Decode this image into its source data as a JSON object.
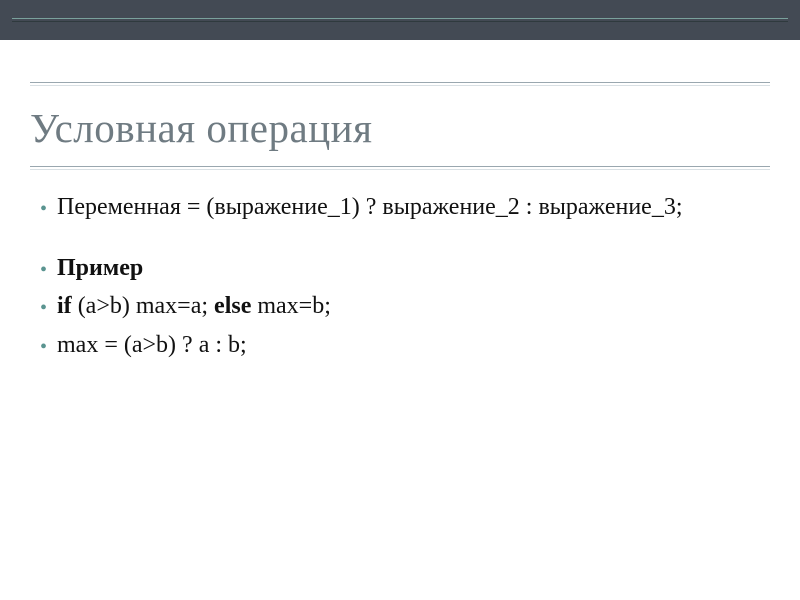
{
  "title": "Условная операция",
  "items": [
    {
      "parts": [
        {
          "text": "Переменная = (выражение_1) ? выражение_2 : выражение_3;",
          "bold": false
        }
      ],
      "gap": true
    },
    {
      "parts": [
        {
          "text": "Пример",
          "bold": true
        }
      ],
      "gap": false
    },
    {
      "parts": [
        {
          "text": "if",
          "bold": true
        },
        {
          "text": " (a>b) max=a; ",
          "bold": false
        },
        {
          "text": "else",
          "bold": true
        },
        {
          "text": " max=b;",
          "bold": false
        }
      ],
      "gap": false
    },
    {
      "parts": [
        {
          "text": "max = (a>b) ? a : b;",
          "bold": false
        }
      ],
      "gap": false
    }
  ]
}
